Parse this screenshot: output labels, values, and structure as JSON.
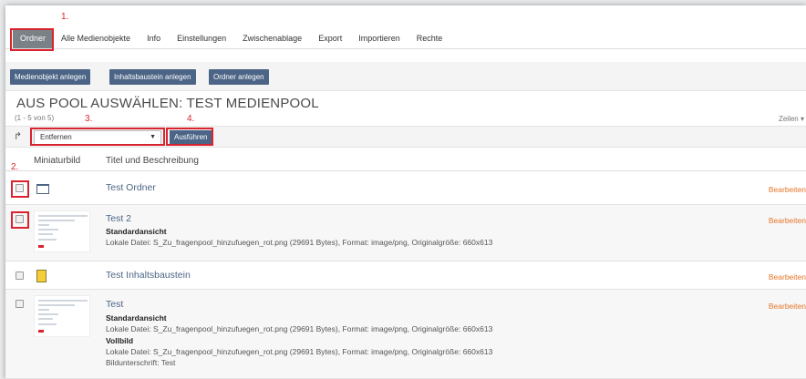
{
  "tabs": [
    "Ordner",
    "Alle Medienobjekte",
    "Info",
    "Einstellungen",
    "Zwischenablage",
    "Export",
    "Importieren",
    "Rechte"
  ],
  "toolbar": {
    "create_media": "Medienobjekt anlegen",
    "create_content": "Inhaltsbaustein anlegen",
    "create_folder": "Ordner anlegen"
  },
  "pool_title": "AUS POOL AUSWÄHLEN: TEST MEDIENPOOL",
  "count": "(1 - 5 von 5)",
  "rows_label": "Zeilen",
  "action": {
    "selected": "Entfernen",
    "execute": "Ausführen"
  },
  "columns": {
    "thumbnail": "Miniaturbild",
    "title": "Titel und Beschreibung"
  },
  "annotations": {
    "a1": "1.",
    "a2": "2.",
    "a3": "3.",
    "a4": "4."
  },
  "items": [
    {
      "title": "Test Ordner",
      "icon": "folder-icon",
      "edit": "Bearbeiten"
    },
    {
      "title": "Test 2",
      "icon": "image-thumbnail",
      "edit": "Bearbeiten",
      "sub1": "Standardansicht",
      "info1": "Lokale Datei: S_Zu_fragenpool_hinzufuegen_rot.png (29691 Bytes), Format: image/png, Originalgröße: 660x613"
    },
    {
      "title": "Test Inhaltsbaustein",
      "icon": "content-block-icon",
      "edit": "Bearbeiten"
    },
    {
      "title": "Test",
      "icon": "image-thumbnail",
      "edit": "Bearbeiten",
      "sub1": "Standardansicht",
      "info1": "Lokale Datei: S_Zu_fragenpool_hinzufuegen_rot.png (29691 Bytes), Format: image/png, Originalgröße: 660x613",
      "sub2": "Vollbild",
      "info2": "Lokale Datei: S_Zu_fragenpool_hinzufuegen_rot.png (29691 Bytes), Format: image/png, Originalgröße: 660x613",
      "caption": "Bildunterschrift: Test"
    }
  ],
  "colors": {
    "accent": "#4c6586",
    "annotation": "#d9232e",
    "edit_link": "#e5762b"
  }
}
